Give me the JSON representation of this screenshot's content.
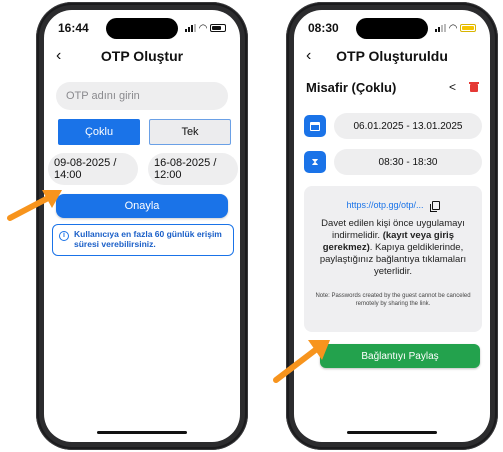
{
  "colors": {
    "accent": "#1a73e8",
    "success": "#23a24d",
    "danger": "#e53935",
    "pointer": "#f7941d"
  },
  "left_screen": {
    "status_time": "16:44",
    "title": "OTP Oluştur",
    "name_input": {
      "placeholder": "OTP adını girin",
      "value": ""
    },
    "mode_multi": "Çoklu",
    "mode_single": "Tek",
    "start_date_line1": "09-08-2025 /",
    "start_date_line2": "14:00",
    "end_date_line1": "16-08-2025 /",
    "end_date_line2": "12:00",
    "confirm_label": "Onayla",
    "info_icon": "info-icon",
    "info_text": "Kullanıcıya en fazla 60 günlük erişim süresi verebilirsiniz."
  },
  "right_screen": {
    "status_time": "08:30",
    "title": "OTP Oluşturuldu",
    "otp_name": "Misafir (Çoklu)",
    "date_range": "06.01.2025 - 13.01.2025",
    "time_range": "08:30 - 18:30",
    "link": "https://otp.gg/otp/...",
    "body_part1": "Davet edilen kişi önce uygulamayı indirmelidir.",
    "body_bold": "(kayıt veya giriş gerekmez)",
    "body_part2": ". Kapıya geldiklerinde, paylaştığınız bağlantıya tıklamaları yeterlidir.",
    "note": "Note: Passwords created by the guest cannot be canceled remotely by sharing the link.",
    "share_label": "Bağlantıyı Paylaş"
  }
}
